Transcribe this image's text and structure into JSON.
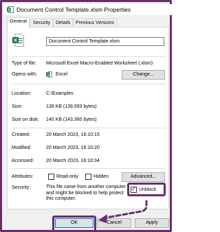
{
  "window": {
    "title": "Document Control Template.xlsm Properties",
    "close_glyph": "✕"
  },
  "tabs": [
    {
      "label": "General",
      "active": true
    },
    {
      "label": "Security",
      "active": false
    },
    {
      "label": "Details",
      "active": false
    },
    {
      "label": "Previous Versions",
      "active": false
    }
  ],
  "file": {
    "name": "Document Control Template.xlsm",
    "type_label": "Type of file:",
    "type_value": "Microsoft Excel Macro-Enabled Worksheet (.xlsm)",
    "opens_label": "Opens with:",
    "opens_value": "Excel",
    "change_button": "Change..."
  },
  "details": {
    "location_label": "Location:",
    "location_value": "C:\\Examples",
    "size_label": "Size:",
    "size_value": "136 KB (139,593 bytes)",
    "size_disk_label": "Size on disk:",
    "size_disk_value": "140 KB (143,360 bytes)",
    "created_label": "Created:",
    "created_value": "20 March 2023, 16:10:15",
    "modified_label": "Modified:",
    "modified_value": "20 March 2023, 16:10:20",
    "accessed_label": "Accessed:",
    "accessed_value": "20 March 2023, 16:10:34"
  },
  "attributes": {
    "label": "Attributes:",
    "readonly_label": "Read-only",
    "readonly_checked": false,
    "hidden_label": "Hidden",
    "hidden_checked": false,
    "advanced_button": "Advanced..."
  },
  "security": {
    "label": "Security:",
    "text": "This file came from another computer and might be blocked to help protect this computer.",
    "unblock_label": "Unblock",
    "unblock_checked": true
  },
  "footer": {
    "ok": "OK",
    "cancel": "Cancel",
    "apply": "Apply"
  },
  "colors": {
    "highlight": "#6a2d6c",
    "excel_green": "#1e7145"
  },
  "icons": {
    "title": "excel-file-icon",
    "file": "excel-file-icon",
    "opens_with": "excel-app-icon"
  }
}
